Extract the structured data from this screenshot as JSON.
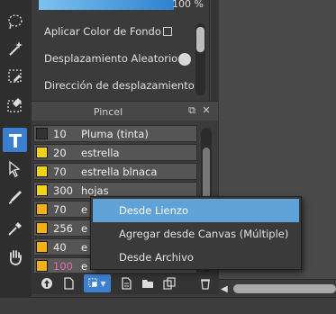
{
  "settings_panel": {
    "opacity_percent": "100 %",
    "rows": [
      {
        "label": "Aplicar Color de Fondo",
        "control": "checkbox",
        "checked": false
      },
      {
        "label": "Desplazamiento Aleatorio",
        "control": "toggle",
        "on": false
      },
      {
        "label": "Dirección de desplazamiento f",
        "control": "none"
      }
    ]
  },
  "brush_panel": {
    "title": "Pincel",
    "brushes": [
      {
        "size": "10",
        "name": "Pluma (tinta)",
        "color": "#333333"
      },
      {
        "size": "20",
        "name": "estrella",
        "color": "#f2d21b"
      },
      {
        "size": "70",
        "name": "estrella blnaca",
        "color": "#f2d21b"
      },
      {
        "size": "300",
        "name": "hojas",
        "color": "#f2d21b"
      },
      {
        "size": "70",
        "name": "e",
        "color": "#f2b01b"
      },
      {
        "size": "256",
        "name": "e",
        "color": "#f2b01b"
      },
      {
        "size": "40",
        "name": "e",
        "color": "#f2b01b"
      },
      {
        "size": "100",
        "name": "e",
        "color": "#f2b01b",
        "selected": true
      }
    ]
  },
  "context_menu": {
    "items": [
      {
        "label": "Desde Lienzo",
        "highlighted": true
      },
      {
        "label": "Agregar desde Canvas (Múltiple)",
        "highlighted": false
      },
      {
        "label": "Desde Archivo",
        "highlighted": false
      }
    ]
  },
  "toolbar": {
    "tools": [
      "lasso-tool-icon",
      "magic-wand-icon",
      "select-erase-icon",
      "eraser-select-icon",
      "text-tool-icon",
      "fill-select-icon",
      "brush-pen-icon",
      "eyedropper-icon",
      "hand-tool-icon"
    ],
    "active_tool": "text-tool-icon"
  },
  "colors": {
    "accent": "#3a7fd0",
    "menu_highlight": "#5ea2d8",
    "selected_size": "#e76aa8"
  }
}
